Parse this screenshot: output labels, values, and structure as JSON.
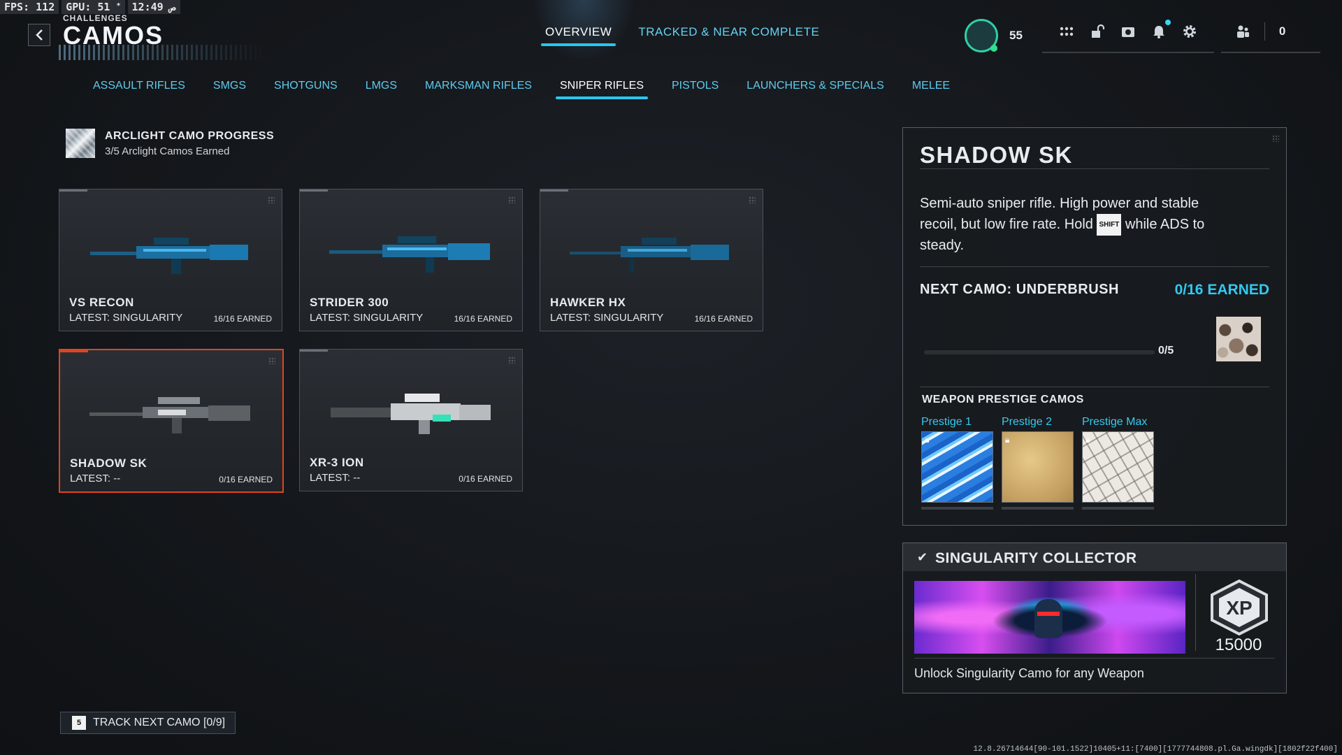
{
  "osd": {
    "fps": "FPS: 112",
    "gpu": "GPU: 51",
    "gpu_mark": "*",
    "clock": "12:49 ص"
  },
  "header": {
    "breadcrumb": "CHALLENGES",
    "title": "CAMOS"
  },
  "top_tabs": [
    {
      "label": "OVERVIEW",
      "active": true
    },
    {
      "label": "TRACKED & NEAR COMPLETE",
      "active": false
    }
  ],
  "player": {
    "level": "55",
    "party_count": "0"
  },
  "icons": [
    "apps-grid-icon",
    "unlock-icon",
    "camera-icon",
    "bell-icon",
    "gear-icon",
    "party-icon"
  ],
  "category_tabs": [
    {
      "label": "ASSAULT RIFLES",
      "active": false
    },
    {
      "label": "SMGS",
      "active": false
    },
    {
      "label": "SHOTGUNS",
      "active": false
    },
    {
      "label": "LMGS",
      "active": false
    },
    {
      "label": "MARKSMAN RIFLES",
      "active": false
    },
    {
      "label": "SNIPER RIFLES",
      "active": true
    },
    {
      "label": "PISTOLS",
      "active": false
    },
    {
      "label": "LAUNCHERS & SPECIALS",
      "active": false
    },
    {
      "label": "MELEE",
      "active": false
    }
  ],
  "arclight": {
    "title": "ARCLIGHT CAMO PROGRESS",
    "subtitle": "3/5 Arclight Camos Earned"
  },
  "weapons": [
    {
      "name": "VS RECON",
      "latest": "LATEST: SINGULARITY",
      "earned": "16/16 EARNED",
      "selected": false
    },
    {
      "name": "STRIDER 300",
      "latest": "LATEST: SINGULARITY",
      "earned": "16/16 EARNED",
      "selected": false
    },
    {
      "name": "HAWKER HX",
      "latest": "LATEST: SINGULARITY",
      "earned": "16/16 EARNED",
      "selected": false
    },
    {
      "name": "SHADOW SK",
      "latest": "LATEST: --",
      "earned": "0/16 EARNED",
      "selected": true
    },
    {
      "name": "XR-3 ION",
      "latest": "LATEST: --",
      "earned": "0/16 EARNED",
      "selected": false
    }
  ],
  "detail": {
    "name": "SHADOW SK",
    "desc_part1": "Semi-auto sniper rifle. High power and stable recoil, but low fire rate. Hold",
    "shift_key": "SHIFT",
    "desc_part2": "while ADS to steady.",
    "next_camo_label": "NEXT CAMO: UNDERBRUSH",
    "next_camo_earned": "0/16 EARNED",
    "progress_text": "0/5",
    "progress_fraction": 0,
    "prestige_title": "WEAPON PRESTIGE CAMOS",
    "prestige": [
      {
        "label": "Prestige 1",
        "locked": true
      },
      {
        "label": "Prestige 2",
        "locked": true
      },
      {
        "label": "Prestige Max",
        "locked": true
      }
    ]
  },
  "challenge": {
    "title": "SINGULARITY COLLECTOR",
    "xp_badge": "XP",
    "xp_reward": "15000",
    "description": "Unlock Singularity Camo for any Weapon"
  },
  "track": {
    "key": "5",
    "label": "TRACK NEXT CAMO [0/9]"
  },
  "build_string": "12.8.26714644[90-101.1522]10405+11:[7400][1777744808.pl.Ga.wingdk][1802f22f400]",
  "colors": {
    "accent": "#27c7ee",
    "selected": "#e0451f",
    "panel_border": "#5a6068"
  }
}
